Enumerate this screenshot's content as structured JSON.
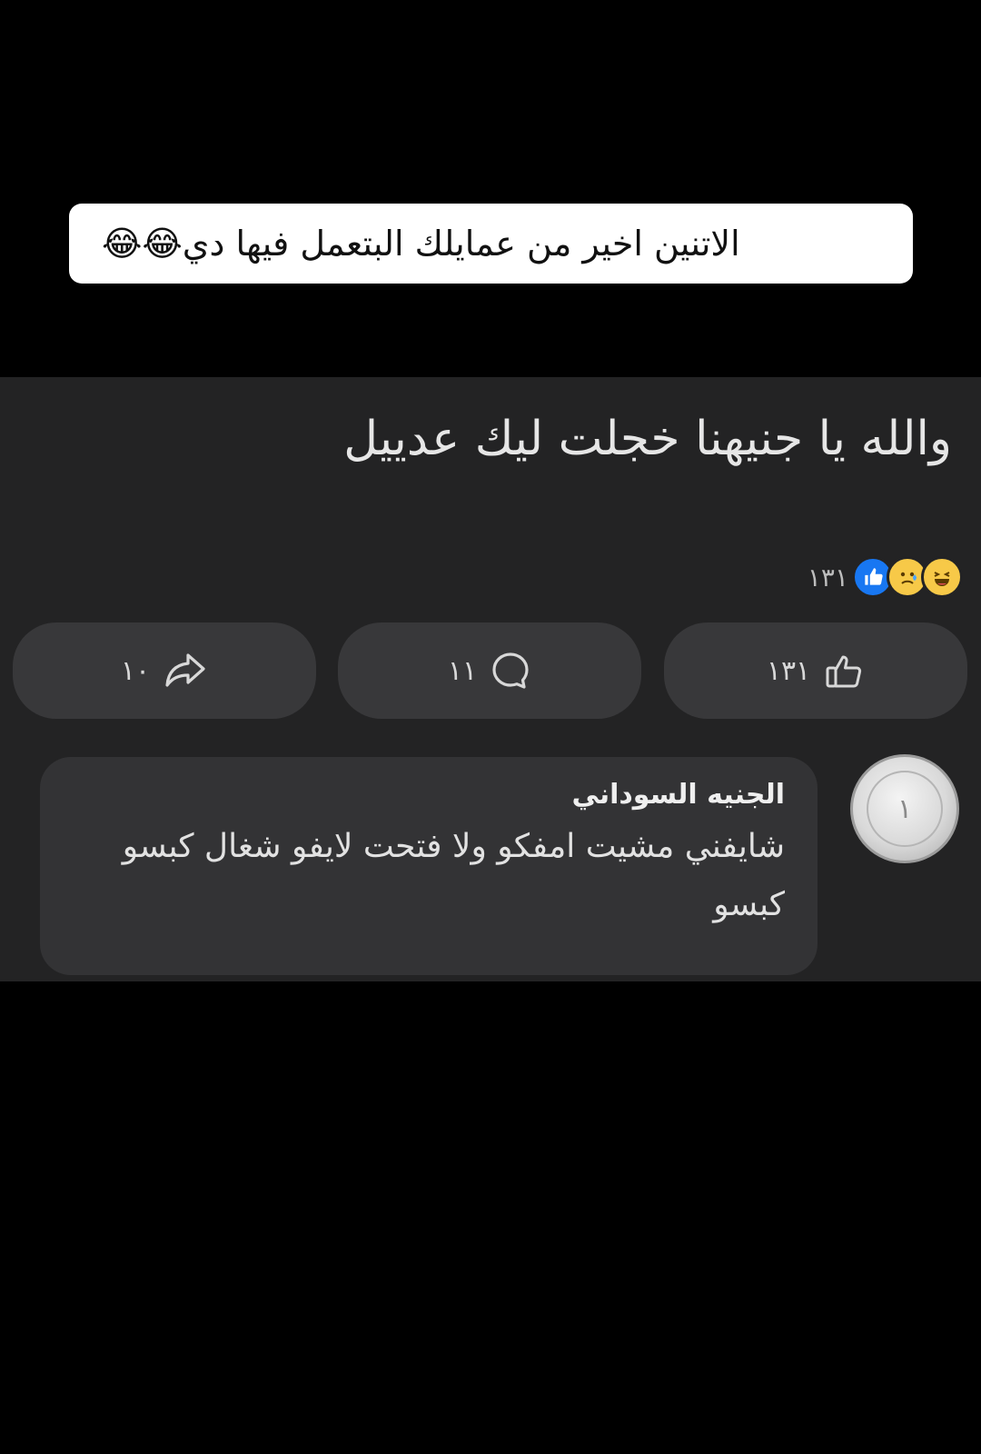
{
  "caption": {
    "text": "الاتنين اخير من عمايلك البتعمل فيها دي😂😂"
  },
  "post": {
    "text": "والله يا جنيهنا خجلت ليك عدييل",
    "reaction_count": "١٣١",
    "reaction_icons": [
      "like-icon",
      "sad-icon",
      "laugh-icon"
    ],
    "actions": {
      "like_count": "١٣١",
      "comment_count": "١١",
      "share_count": "١٠"
    }
  },
  "comment": {
    "author": "الجنيه السوداني",
    "body": "شايفني مشيت امفكو ولا فتحت لايفو شغال كبسو كبسو",
    "avatar_glyph": "١"
  },
  "colors": {
    "page_background": "#000000",
    "post_background": "#232324",
    "button_background": "#38383a",
    "comment_background": "#333335",
    "like_blue": "#1877f2",
    "emoji_yellow": "#f7c948"
  }
}
